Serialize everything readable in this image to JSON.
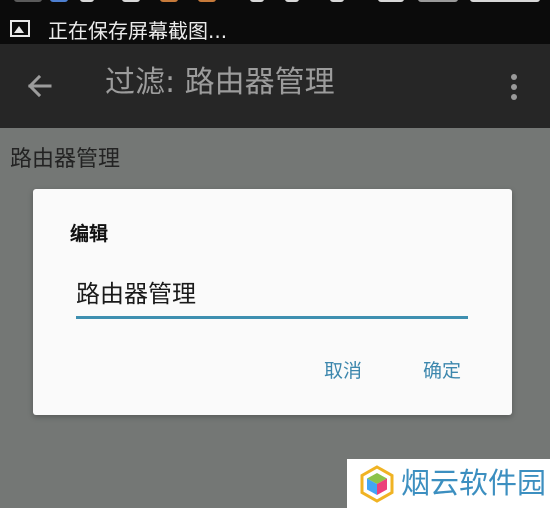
{
  "status_bar": {
    "notification_text": "正在保存屏幕截图..."
  },
  "toolbar": {
    "title": "过滤: 路由器管理",
    "back_icon": "arrow-left-icon",
    "menu_icon": "more-vert-icon"
  },
  "list": {
    "items": [
      {
        "label": "路由器管理"
      }
    ]
  },
  "dialog": {
    "title": "编辑",
    "input_value": "路由器管理",
    "cancel_label": "取消",
    "confirm_label": "确定"
  },
  "watermark": {
    "text": "烟云软件园",
    "logo_icon": "hexagon-cube-logo"
  },
  "colors": {
    "toolbar_bg": "#262626",
    "scrim": "#747775",
    "accent": "#3e8fb0",
    "button_text": "#3d87ad"
  }
}
